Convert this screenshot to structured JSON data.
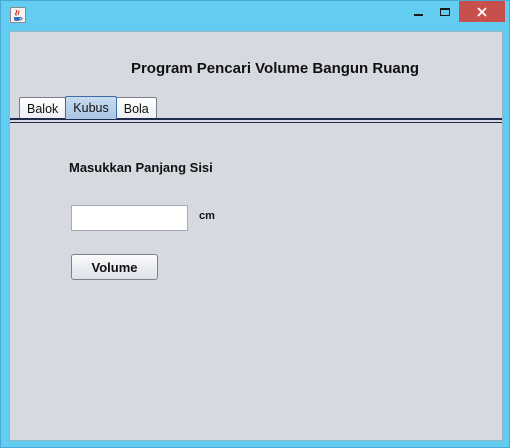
{
  "window": {
    "icons": {
      "app": "java-cup-icon",
      "minimize": "minimize-icon",
      "maximize": "maximize-icon",
      "close": "close-icon"
    },
    "colors": {
      "titlebar": "#62cdf0",
      "close_button": "#c7504c",
      "client_bg": "#d6d9e0"
    }
  },
  "content": {
    "title": "Program Pencari Volume Bangun Ruang",
    "tabs": [
      {
        "label": "Balok",
        "active": false
      },
      {
        "label": "Kubus",
        "active": true
      },
      {
        "label": "Bola",
        "active": false
      }
    ],
    "prompt": "Masukkan Panjang Sisi",
    "side_input": {
      "value": "",
      "placeholder": ""
    },
    "unit": "cm",
    "volume_button": "Volume"
  }
}
